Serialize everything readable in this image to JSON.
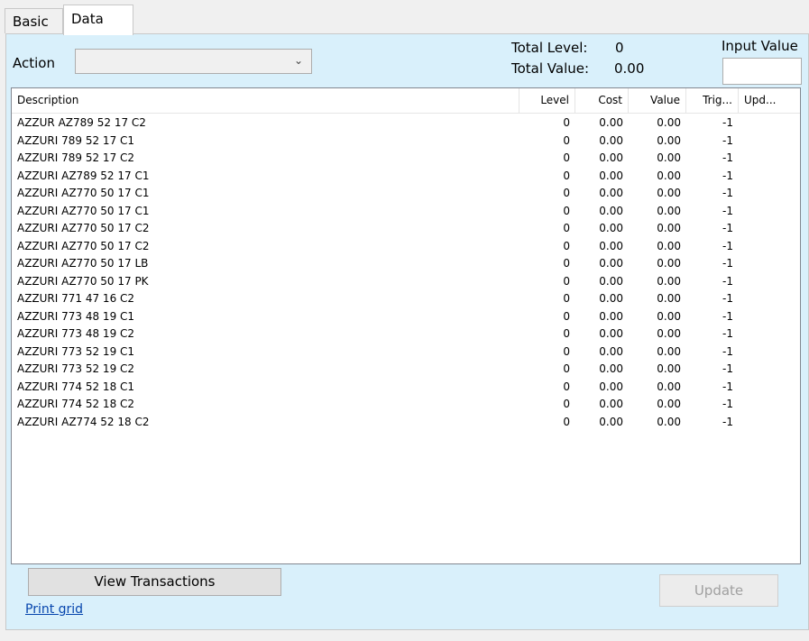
{
  "tabs": [
    {
      "label": "Basic",
      "active": false
    },
    {
      "label": "Data",
      "active": true
    }
  ],
  "action": {
    "label": "Action",
    "selected_value": ""
  },
  "totals": {
    "level_label": "Total Level:",
    "level_value": "0",
    "value_label": "Total Value:",
    "value_value": "0.00"
  },
  "input_value": {
    "label": "Input Value",
    "value": ""
  },
  "grid": {
    "columns": [
      "Description",
      "Level",
      "Cost",
      "Value",
      "Trig...",
      "Upd..."
    ],
    "rows": [
      {
        "description": "AZZUR AZ789 52 17 C2",
        "level": "0",
        "cost": "0.00",
        "value": "0.00",
        "trig": "-1",
        "upd": ""
      },
      {
        "description": "AZZURI 789 52 17 C1",
        "level": "0",
        "cost": "0.00",
        "value": "0.00",
        "trig": "-1",
        "upd": ""
      },
      {
        "description": "AZZURI 789 52 17 C2",
        "level": "0",
        "cost": "0.00",
        "value": "0.00",
        "trig": "-1",
        "upd": ""
      },
      {
        "description": "AZZURI AZ789 52 17 C1",
        "level": "0",
        "cost": "0.00",
        "value": "0.00",
        "trig": "-1",
        "upd": ""
      },
      {
        "description": "AZZURI AZ770 50 17 C1",
        "level": "0",
        "cost": "0.00",
        "value": "0.00",
        "trig": "-1",
        "upd": ""
      },
      {
        "description": "AZZURI AZ770 50 17 C1",
        "level": "0",
        "cost": "0.00",
        "value": "0.00",
        "trig": "-1",
        "upd": ""
      },
      {
        "description": "AZZURI AZ770 50 17 C2",
        "level": "0",
        "cost": "0.00",
        "value": "0.00",
        "trig": "-1",
        "upd": ""
      },
      {
        "description": "AZZURI AZ770 50 17 C2",
        "level": "0",
        "cost": "0.00",
        "value": "0.00",
        "trig": "-1",
        "upd": ""
      },
      {
        "description": "AZZURI AZ770 50 17 LB",
        "level": "0",
        "cost": "0.00",
        "value": "0.00",
        "trig": "-1",
        "upd": ""
      },
      {
        "description": "AZZURI AZ770 50 17 PK",
        "level": "0",
        "cost": "0.00",
        "value": "0.00",
        "trig": "-1",
        "upd": ""
      },
      {
        "description": "AZZURI 771 47 16 C2",
        "level": "0",
        "cost": "0.00",
        "value": "0.00",
        "trig": "-1",
        "upd": ""
      },
      {
        "description": "AZZURI 773 48 19 C1",
        "level": "0",
        "cost": "0.00",
        "value": "0.00",
        "trig": "-1",
        "upd": ""
      },
      {
        "description": "AZZURI 773 48 19 C2",
        "level": "0",
        "cost": "0.00",
        "value": "0.00",
        "trig": "-1",
        "upd": ""
      },
      {
        "description": "AZZURI 773 52 19 C1",
        "level": "0",
        "cost": "0.00",
        "value": "0.00",
        "trig": "-1",
        "upd": ""
      },
      {
        "description": "AZZURI 773 52 19 C2",
        "level": "0",
        "cost": "0.00",
        "value": "0.00",
        "trig": "-1",
        "upd": ""
      },
      {
        "description": "AZZURI 774 52 18 C1",
        "level": "0",
        "cost": "0.00",
        "value": "0.00",
        "trig": "-1",
        "upd": ""
      },
      {
        "description": "AZZURI 774 52 18 C2",
        "level": "0",
        "cost": "0.00",
        "value": "0.00",
        "trig": "-1",
        "upd": ""
      },
      {
        "description": "AZZURI AZ774 52 18 C2",
        "level": "0",
        "cost": "0.00",
        "value": "0.00",
        "trig": "-1",
        "upd": ""
      }
    ]
  },
  "buttons": {
    "view_transactions": "View Transactions",
    "update": "Update",
    "update_enabled": false
  },
  "print_grid_link": "Print grid",
  "colors": {
    "panel_bg": "#d9f0fb",
    "link": "#0645ad",
    "disabled_text": "#a0a0a0"
  }
}
